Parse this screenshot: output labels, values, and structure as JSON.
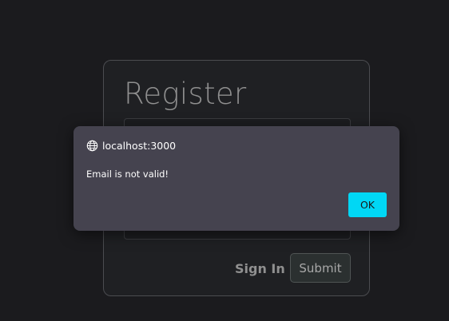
{
  "register_card": {
    "title": "Register",
    "signin_label": "Sign In",
    "submit_label": "Submit"
  },
  "alert_dialog": {
    "origin": "localhost:3000",
    "message": "Email is not valid!",
    "ok_label": "OK",
    "origin_icon": "globe-icon"
  },
  "colors": {
    "page_background": "#1b1b1e",
    "dialog_background": "#45434f",
    "ok_button": "#00d7f5"
  }
}
